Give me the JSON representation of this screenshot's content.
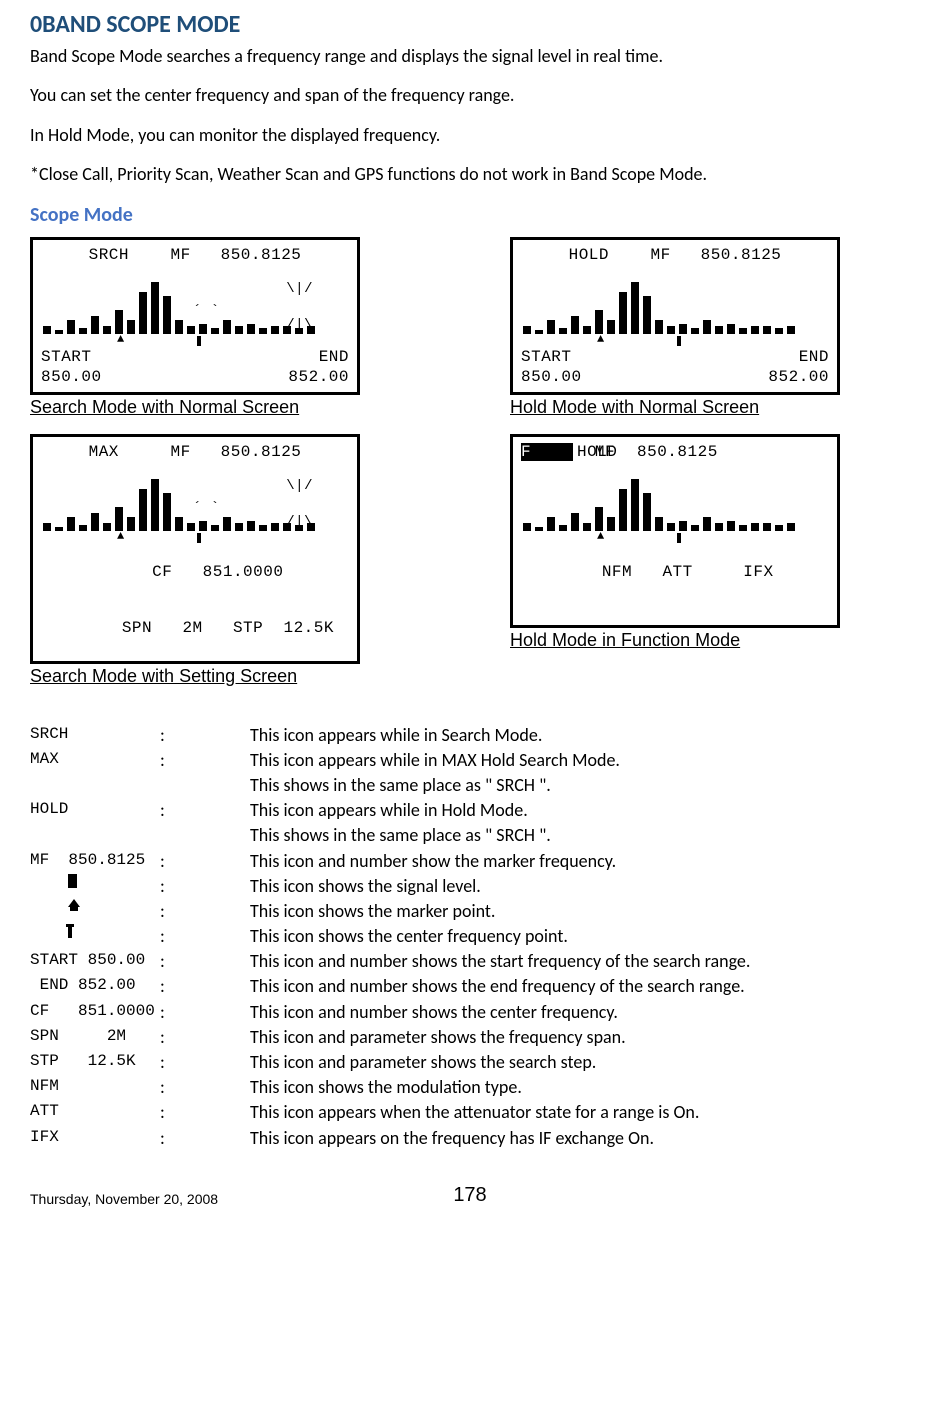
{
  "title": "0BAND SCOPE MODE",
  "paras": [
    "Band Scope Mode searches a frequency range and displays the signal level in real time.",
    "You can set the center frequency and span of the frequency range.",
    "In Hold Mode, you can monitor the displayed frequency.",
    "*Close Call, Priority Scan, Weather Scan and GPS functions do not work in Band Scope Mode."
  ],
  "subhead": "Scope Mode",
  "screens": {
    "srch": {
      "mode": "SRCH",
      "mf_label": "MF",
      "mf_value": "850.8125",
      "start_label": "START",
      "end_label": "END",
      "start_val": "850.00",
      "end_val": "852.00",
      "caption": "Search Mode with Normal Screen",
      "bars": [
        8,
        4,
        14,
        6,
        18,
        8,
        24,
        14,
        42,
        52,
        38,
        14,
        8,
        10,
        6,
        14,
        8,
        10,
        6,
        8,
        8,
        6,
        8
      ],
      "sparkle": true
    },
    "max": {
      "mode": "MAX",
      "mf_label": "MF",
      "mf_value": "850.8125",
      "cf_label": "CF",
      "cf_value": "851.0000",
      "spn_label": "SPN",
      "spn_value": "2M",
      "stp_label": "STP",
      "stp_value": "12.5K",
      "caption": "Search Mode with Setting Screen",
      "bars": [
        8,
        4,
        14,
        6,
        18,
        8,
        24,
        14,
        42,
        52,
        38,
        14,
        8,
        10,
        6,
        14,
        8,
        10,
        6,
        8,
        8,
        6,
        8
      ],
      "sparkle": true
    },
    "hold": {
      "mode": "HOLD",
      "mf_label": "MF",
      "mf_value": "850.8125",
      "start_label": "START",
      "end_label": "END",
      "start_val": "850.00",
      "end_val": "852.00",
      "caption": "Hold Mode with Normal Screen",
      "bars": [
        8,
        4,
        14,
        6,
        18,
        8,
        24,
        14,
        42,
        52,
        38,
        14,
        8,
        10,
        6,
        14,
        8,
        10,
        6,
        8,
        8,
        6,
        8
      ],
      "sparkle": false
    },
    "fhold": {
      "f_flag": "F",
      "mode": "HOLD",
      "mf_label": "MF",
      "mf_value": "850.8125",
      "nfm": "NFM",
      "att": "ATT",
      "ifx": "IFX",
      "caption": "Hold Mode in Function Mode",
      "bars": [
        8,
        4,
        14,
        6,
        18,
        8,
        24,
        14,
        42,
        52,
        38,
        14,
        8,
        10,
        6,
        14,
        8,
        10,
        6,
        8,
        8,
        6,
        8
      ],
      "sparkle": false
    }
  },
  "defs": [
    {
      "label": "SRCH",
      "desc": "This icon appears while in Search Mode."
    },
    {
      "label": "MAX",
      "desc": "This icon appears while in MAX Hold Search Mode."
    },
    {
      "label": "",
      "desc": "This shows in the same place as \" SRCH \"."
    },
    {
      "label": "HOLD",
      "desc": "This icon appears while in Hold Mode."
    },
    {
      "label": "",
      "desc": "This shows in the same place as \" SRCH \"."
    },
    {
      "label": "MF  850.8125",
      "colon": ":",
      "desc": "This icon and number show the marker frequency."
    },
    {
      "icon": "square",
      "desc": "This icon shows the signal level."
    },
    {
      "icon": "house",
      "desc": "This icon shows the marker point."
    },
    {
      "icon": "tick",
      "desc": "This icon shows the center frequency point."
    },
    {
      "label": "START 850.00",
      "colon": ":",
      "desc": "This icon and number shows the start frequency of the search range."
    },
    {
      "label": " END 852.00 ",
      "colon": ":",
      "desc": "This icon and number shows the end frequency of the search range."
    },
    {
      "label": "CF   851.0000",
      "colon": ":",
      "desc": "This icon and number shows the center frequency."
    },
    {
      "label": "SPN     2M ",
      "colon": ":",
      "desc": "This icon and parameter shows the frequency span."
    },
    {
      "label": "STP   12.5K",
      "colon": ":",
      "desc": "This icon and parameter shows the search step."
    },
    {
      "label": "NFM",
      "desc": "This icon shows the modulation type."
    },
    {
      "label": "ATT",
      "desc": "This icon appears when the attenuator state for a range is On."
    },
    {
      "label": "IFX",
      "desc": "This icon appears on the frequency has IF exchange On."
    }
  ],
  "default_colon": ":",
  "footer": {
    "date": "Thursday, November 20, 2008",
    "page": "178"
  }
}
